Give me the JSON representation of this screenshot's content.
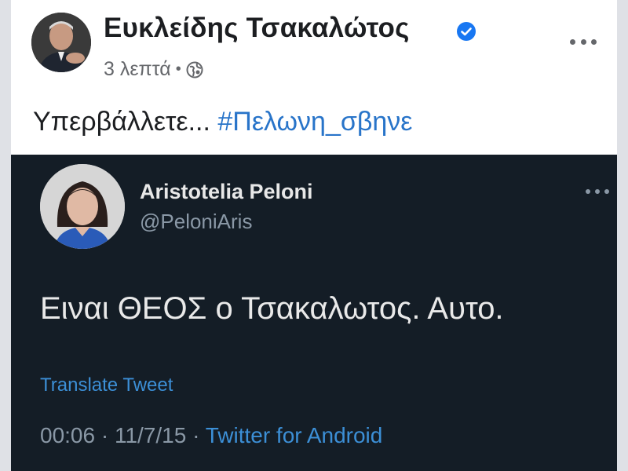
{
  "facebook_post": {
    "author": "Ευκλείδης Τσακαλώτος",
    "time": "3 λεπτά",
    "separator": "•",
    "text": "Υπερβάλλετε...",
    "hashtag": "#Πελωνη_σβηνε",
    "icons": {
      "verified": "verified-badge-icon",
      "audience": "globe-icon",
      "more": "more-options-icon"
    },
    "colors": {
      "link": "#2874c9",
      "verified": "#1877f2"
    }
  },
  "tweet": {
    "author": "Aristotelia Peloni",
    "handle": "@PeloniAris",
    "text": "Ειναι ΘΕΟΣ ο Τσακαλωτος. Αυτο.",
    "translate_label": "Translate Tweet",
    "timestamp": "00:06 · 11/7/15 ·",
    "source": "Twitter for Android",
    "colors": {
      "background": "#141d26",
      "link": "#3c8fd6"
    }
  }
}
